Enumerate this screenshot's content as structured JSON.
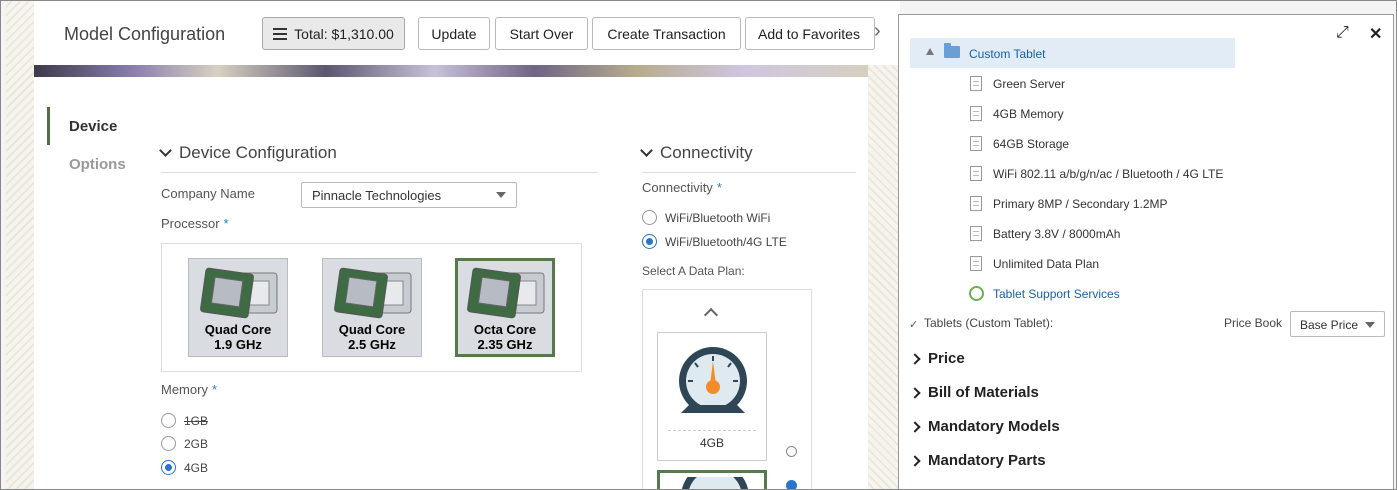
{
  "header": {
    "title": "Model Configuration",
    "total_label": "Total: $1,310.00",
    "buttons": {
      "update": "Update",
      "start_over": "Start Over",
      "create_transaction": "Create Transaction",
      "add_to_favorites": "Add to Favorites"
    }
  },
  "nav": {
    "items": [
      {
        "label": "Device",
        "active": true
      },
      {
        "label": "Options",
        "active": false
      }
    ]
  },
  "device_config": {
    "title": "Device Configuration",
    "company_name_label": "Company Name",
    "company_name_value": "Pinnacle Technologies",
    "processor_label": "Processor",
    "required_mark": "*",
    "processors": [
      {
        "line1": "Quad Core",
        "line2": "1.9 GHz",
        "selected": false
      },
      {
        "line1": "Quad Core",
        "line2": "2.5 GHz",
        "selected": false
      },
      {
        "line1": "Octa Core",
        "line2": "2.35 GHz",
        "selected": true
      }
    ],
    "memory_label": "Memory",
    "memory_options": [
      {
        "label": "1GB",
        "selected": false,
        "unavailable": true
      },
      {
        "label": "2GB",
        "selected": false,
        "unavailable": false
      },
      {
        "label": "4GB",
        "selected": true,
        "unavailable": false
      }
    ]
  },
  "connectivity": {
    "title": "Connectivity",
    "field_label": "Connectivity",
    "options": [
      {
        "label": "WiFi/Bluetooth WiFi",
        "selected": false
      },
      {
        "label": "WiFi/Bluetooth/4G LTE",
        "selected": true
      }
    ],
    "data_plan_label": "Select A Data Plan:",
    "plans": [
      {
        "label": "4GB",
        "selected": false
      },
      {
        "label": "",
        "selected": true
      }
    ]
  },
  "tree_panel": {
    "root": "Custom Tablet",
    "items": [
      "Green Server",
      "4GB Memory",
      "64GB Storage",
      "WiFi 802.11 a/b/g/n/ac / Bluetooth / 4G LTE",
      "Primary 8MP / Secondary 1.2MP",
      "Battery 3.8V / 8000mAh",
      "Unlimited Data Plan"
    ],
    "service_item": "Tablet Support Services",
    "summary_label": "Tablets (Custom Tablet):",
    "checkmark": "✓",
    "price_book_label": "Price Book",
    "price_book_value": "Base Price",
    "sections": [
      "Price",
      "Bill of Materials",
      "Mandatory Models",
      "Mandatory Parts"
    ]
  },
  "icons": {
    "expand": "expand-icon",
    "close": "close-icon",
    "more": "chevron-right-icon",
    "total": "list-icon"
  },
  "colors": {
    "accent_green": "#577a4c",
    "radio_blue": "#2a74c9",
    "link_blue": "#1a5fa8",
    "gauge_orange": "#f28c28"
  }
}
